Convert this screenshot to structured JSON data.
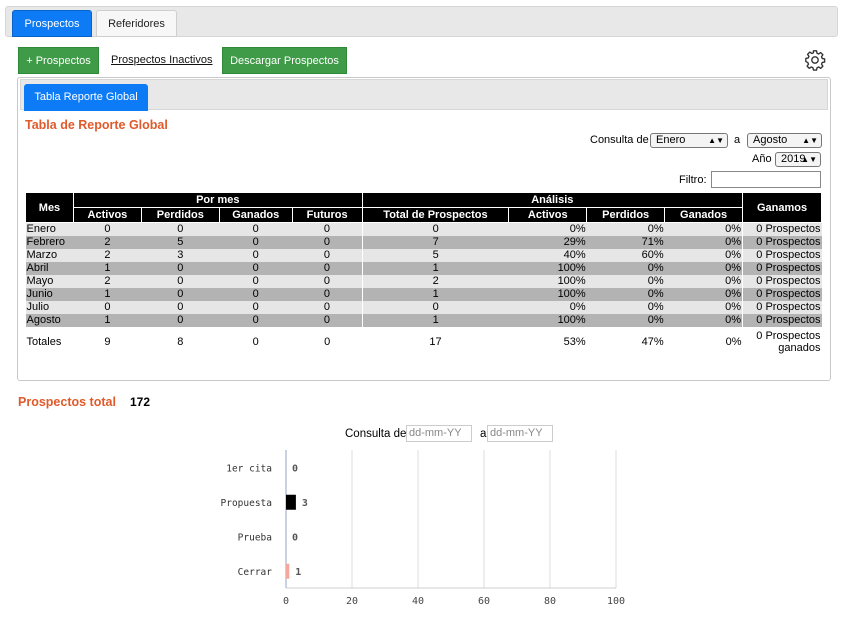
{
  "tabs": [
    {
      "label": "Prospectos"
    },
    {
      "label": "Referidores"
    }
  ],
  "actions": {
    "add_prospect": "+ Prospectos",
    "inactive_link": "Prospectos Inactivos",
    "download": "Descargar Prospectos"
  },
  "panel": {
    "tab_label": "Tabla Reporte Global",
    "title": "Tabla de Reporte Global",
    "consulta_label": "Consulta de",
    "from_month": "Enero",
    "a_label": "a",
    "to_month": "Agosto",
    "year_label": "Año",
    "year": "2019",
    "filter_label": "Filtro:"
  },
  "table": {
    "h_mes": "Mes",
    "h_pormes": "Por mes",
    "h_analisis": "Análisis",
    "h_ganamos": "Ganamos",
    "sub": [
      "Activos",
      "Perdidos",
      "Ganados",
      "Futuros",
      "Total de Prospectos",
      "Activos",
      "Perdidos",
      "Ganados"
    ],
    "rows": [
      [
        "Enero",
        "0",
        "0",
        "0",
        "0",
        "0",
        "0%",
        "0%",
        "0%",
        "0 Prospectos"
      ],
      [
        "Febrero",
        "2",
        "5",
        "0",
        "0",
        "7",
        "29%",
        "71%",
        "0%",
        "0 Prospectos"
      ],
      [
        "Marzo",
        "2",
        "3",
        "0",
        "0",
        "5",
        "40%",
        "60%",
        "0%",
        "0 Prospectos"
      ],
      [
        "Abril",
        "1",
        "0",
        "0",
        "0",
        "1",
        "100%",
        "0%",
        "0%",
        "0 Prospectos"
      ],
      [
        "Mayo",
        "2",
        "0",
        "0",
        "0",
        "2",
        "100%",
        "0%",
        "0%",
        "0 Prospectos"
      ],
      [
        "Junio",
        "1",
        "0",
        "0",
        "0",
        "1",
        "100%",
        "0%",
        "0%",
        "0 Prospectos"
      ],
      [
        "Julio",
        "0",
        "0",
        "0",
        "0",
        "0",
        "0%",
        "0%",
        "0%",
        "0 Prospectos"
      ],
      [
        "Agosto",
        "1",
        "0",
        "0",
        "0",
        "1",
        "100%",
        "0%",
        "0%",
        "0 Prospectos"
      ]
    ],
    "totals": [
      "Totales",
      "9",
      "8",
      "0",
      "0",
      "17",
      "53%",
      "47%",
      "0%",
      "0 Prospectos ganados"
    ]
  },
  "summary": {
    "label": "Prospectos total",
    "value": "172"
  },
  "date_filter": {
    "consulta_label": "Consulta de",
    "from_placeholder": "dd-mm-YY",
    "a_label": "a",
    "to_placeholder": "dd-mm-YY"
  },
  "colors": {
    "primary": "#0d7bf6",
    "green": "#3f9b48",
    "accent": "#e05a2b"
  },
  "chart_data": {
    "type": "bar",
    "orientation": "horizontal",
    "categories": [
      "1er cita",
      "Propuesta",
      "Prueba",
      "Cerrar"
    ],
    "values": [
      0,
      3,
      0,
      1
    ],
    "bar_colors": [
      "#000000",
      "#000000",
      "#000000",
      "#f4a79a"
    ],
    "xlim": [
      0,
      100
    ],
    "xticks": [
      0,
      20,
      40,
      60,
      80,
      100
    ],
    "grid": true
  }
}
